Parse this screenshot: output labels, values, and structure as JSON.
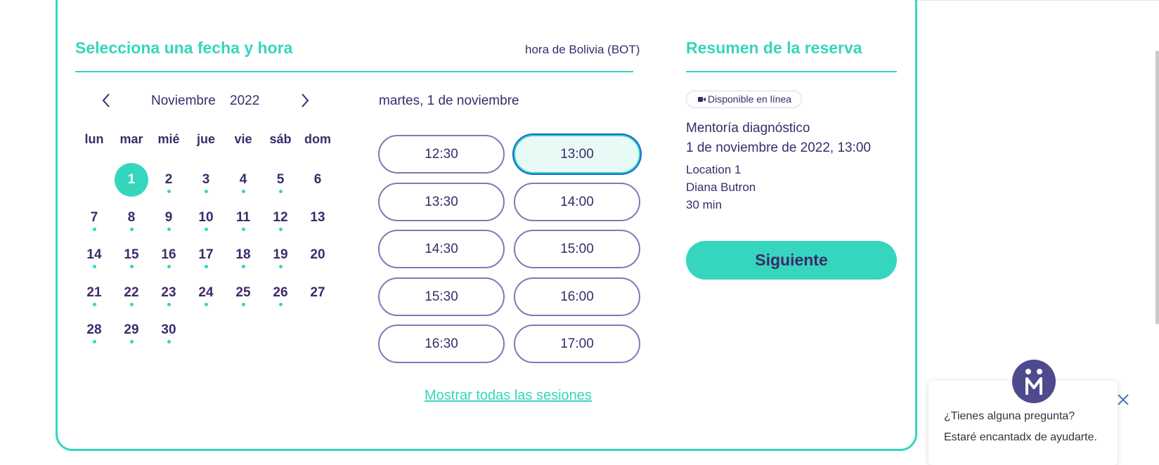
{
  "booking": {
    "title": "Selecciona una fecha y hora",
    "timezone": "hora de Bolivia (BOT)"
  },
  "calendar": {
    "month": "Noviembre",
    "year": "2022",
    "prev_icon": "chevron-left-icon",
    "next_icon": "chevron-right-icon",
    "weekdays": [
      "lun",
      "mar",
      "mié",
      "jue",
      "vie",
      "sáb",
      "dom"
    ],
    "days": [
      {
        "label": "1",
        "available": true,
        "selected": true
      },
      {
        "label": "2",
        "available": true
      },
      {
        "label": "3",
        "available": true
      },
      {
        "label": "4",
        "available": true
      },
      {
        "label": "5",
        "available": true
      },
      {
        "label": "6",
        "available": false
      },
      {
        "label": "7",
        "available": true
      },
      {
        "label": "8",
        "available": true
      },
      {
        "label": "9",
        "available": true
      },
      {
        "label": "10",
        "available": true
      },
      {
        "label": "11",
        "available": true
      },
      {
        "label": "12",
        "available": true
      },
      {
        "label": "13",
        "available": false
      },
      {
        "label": "14",
        "available": true
      },
      {
        "label": "15",
        "available": true
      },
      {
        "label": "16",
        "available": true
      },
      {
        "label": "17",
        "available": true
      },
      {
        "label": "18",
        "available": true
      },
      {
        "label": "19",
        "available": true
      },
      {
        "label": "20",
        "available": false
      },
      {
        "label": "21",
        "available": true
      },
      {
        "label": "22",
        "available": true
      },
      {
        "label": "23",
        "available": true
      },
      {
        "label": "24",
        "available": true
      },
      {
        "label": "25",
        "available": true
      },
      {
        "label": "26",
        "available": true
      },
      {
        "label": "27",
        "available": false
      },
      {
        "label": "28",
        "available": true
      },
      {
        "label": "29",
        "available": true
      },
      {
        "label": "30",
        "available": true
      }
    ]
  },
  "slots": {
    "date_heading": "martes, 1 de noviembre",
    "times": [
      "12:30",
      "13:00",
      "13:30",
      "14:00",
      "14:30",
      "15:00",
      "15:30",
      "16:00",
      "16:30",
      "17:00"
    ],
    "selected": "13:00",
    "show_all": "Mostrar todas las sesiones"
  },
  "summary": {
    "title": "Resumen de la reserva",
    "badge_icon": "video-camera-icon",
    "badge": "Disponible en línea",
    "service": "Mentoría diagnóstico",
    "datetime": "1 de noviembre de 2022, 13:00",
    "location": "Location 1",
    "staff": "Diana Butron",
    "duration": "30 min",
    "next_label": "Siguiente"
  },
  "chat": {
    "line1": "¿Tienes alguna pregunta?",
    "line2": "Estaré encantadx de ayudarte.",
    "close_icon": "close-icon",
    "avatar_icon": "mentor-logo-icon"
  },
  "colors": {
    "accent": "#35d6bd",
    "text": "#3c2a6b",
    "slot_border": "#8a74b5",
    "focus_ring": "#1a63d4"
  }
}
